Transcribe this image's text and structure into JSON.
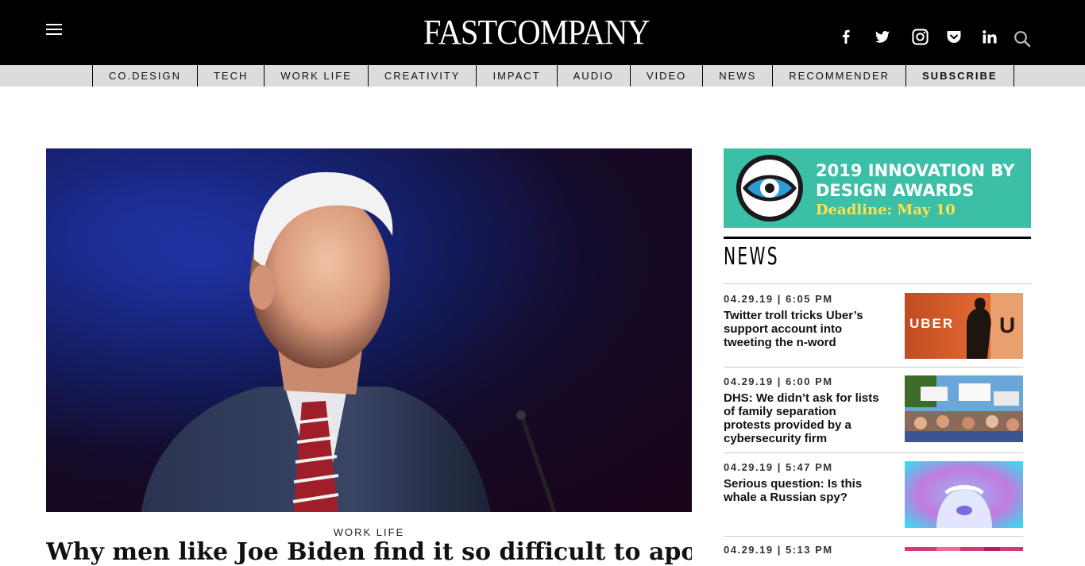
{
  "header": {
    "logo_text": "FASTCOMPANY",
    "social_icons": [
      "facebook-icon",
      "twitter-icon",
      "instagram-icon",
      "pocket-icon",
      "linkedin-icon",
      "search-icon"
    ]
  },
  "nav": {
    "items": [
      {
        "label": "CO.DESIGN"
      },
      {
        "label": "TECH"
      },
      {
        "label": "WORK LIFE"
      },
      {
        "label": "CREATIVITY"
      },
      {
        "label": "IMPACT"
      },
      {
        "label": "AUDIO"
      },
      {
        "label": "VIDEO"
      },
      {
        "label": "NEWS"
      },
      {
        "label": "RECOMMENDER"
      },
      {
        "label": "SUBSCRIBE"
      }
    ]
  },
  "article": {
    "category": "WORK LIFE",
    "title": "Why men like Joe Biden find it so difficult to apologize"
  },
  "ad": {
    "title": "2019 INNOVATION BY DESIGN AWARDS",
    "deadline": "Deadline: May 10"
  },
  "news": {
    "section_title": "NEWS",
    "items": [
      {
        "date": "04.29.19 | 6:05 PM",
        "headline": "Twitter troll tricks Uber’s support account into tweeting the n-word",
        "thumb_text": "UBER"
      },
      {
        "date": "04.29.19 | 6:00 PM",
        "headline": "DHS: We didn’t ask for lists of family separation protests provided by a cybersecurity firm"
      },
      {
        "date": "04.29.19 | 5:47 PM",
        "headline": "Serious question: Is this whale a Russian spy?"
      },
      {
        "date": "04.29.19 | 5:13 PM",
        "headline": ""
      }
    ]
  },
  "colors": {
    "header_bg": "#000000",
    "nav_bg": "#dcdcdc",
    "ad_bg": "#3bbfa6",
    "ad_deadline": "#ffe14d"
  }
}
